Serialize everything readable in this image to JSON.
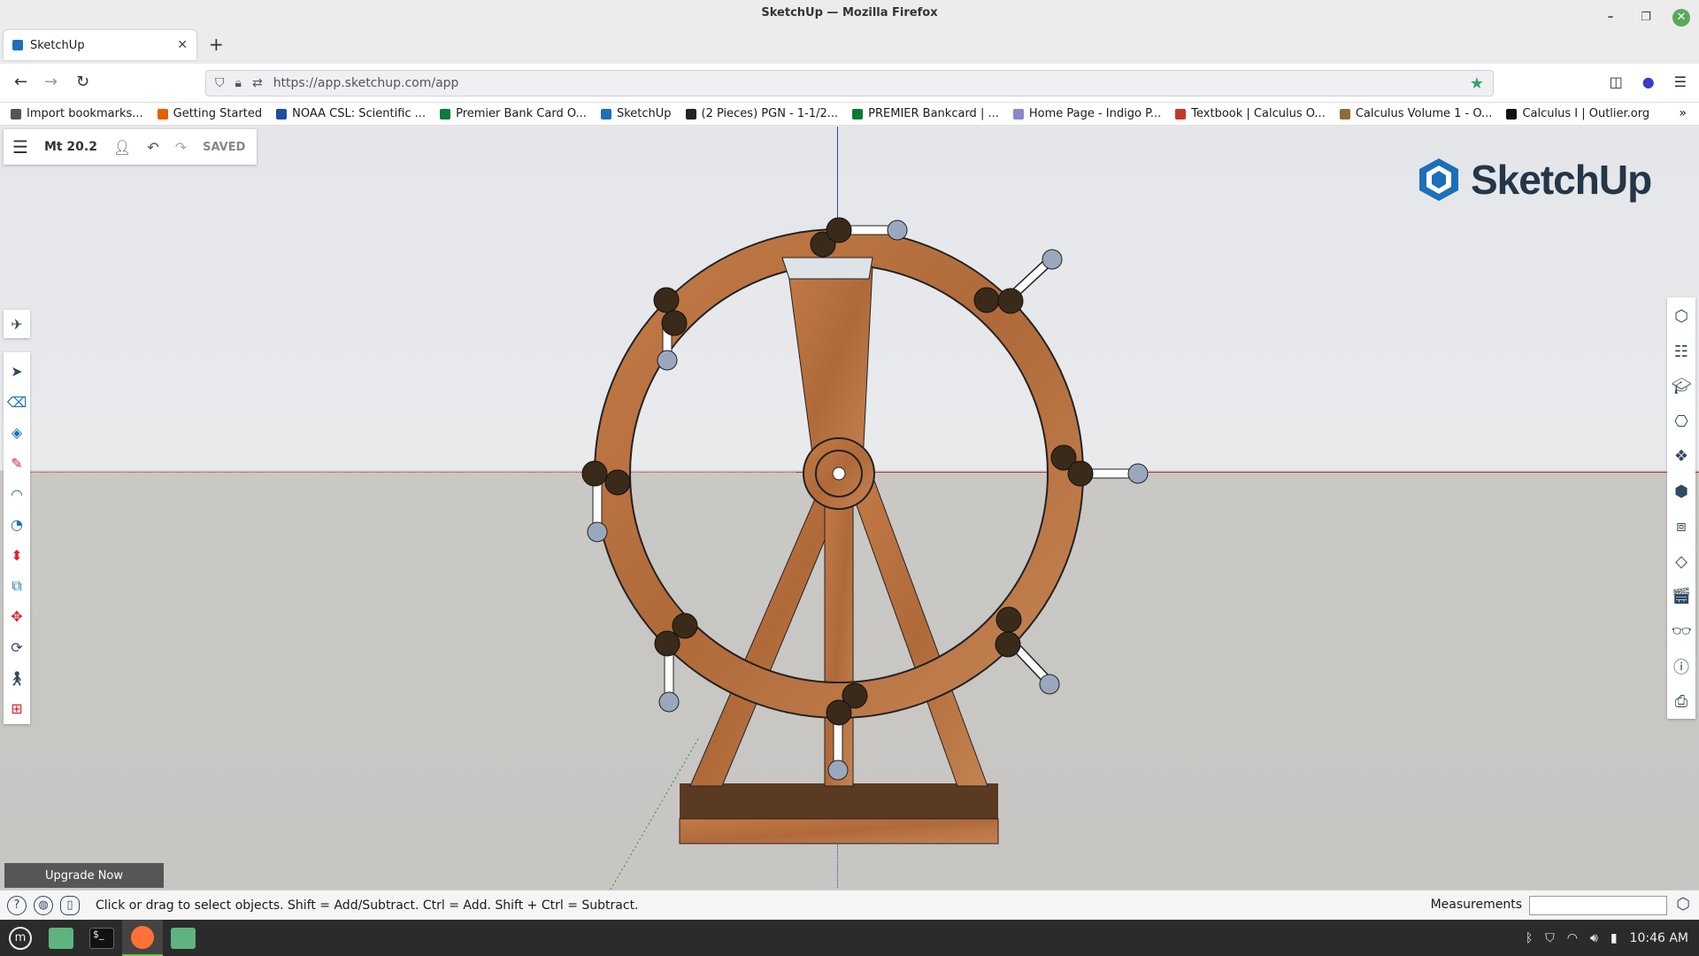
{
  "window": {
    "title": "SketchUp — Mozilla Firefox",
    "controls": {
      "minimize": "–",
      "maximize": "❐",
      "close": "✕"
    }
  },
  "browser": {
    "tab_title": "SketchUp",
    "tab_close": "✕",
    "new_tab": "+",
    "url": "https://app.sketchup.com/app",
    "bookmarks": [
      {
        "label": "Import bookmarks...",
        "color": "#555555"
      },
      {
        "label": "Getting Started",
        "color": "#e66000"
      },
      {
        "label": "NOAA CSL: Scientific ...",
        "color": "#1f4e9c"
      },
      {
        "label": "Premier Bank Card O...",
        "color": "#0a7a3a"
      },
      {
        "label": "SketchUp",
        "color": "#1d6fb8"
      },
      {
        "label": "(2 Pieces) PGN - 1-1/2...",
        "color": "#222222"
      },
      {
        "label": "PREMIER Bankcard | ...",
        "color": "#0a7a3a"
      },
      {
        "label": "Home Page - Indigo P...",
        "color": "#8888cc"
      },
      {
        "label": "Textbook | Calculus O...",
        "color": "#c0392b"
      },
      {
        "label": "Calculus Volume 1 - O...",
        "color": "#8a6d3b"
      },
      {
        "label": "Calculus I | Outlier.org",
        "color": "#111111"
      }
    ]
  },
  "sketchup": {
    "model_name": "Mt 20.2",
    "save_status": "SAVED",
    "logo_text": "SketchUp",
    "upgrade_label": "Upgrade Now",
    "status_text": "Click or drag to select objects. Shift = Add/Subtract. Ctrl = Add. Shift + Ctrl = Subtract.",
    "measurements_label": "Measurements",
    "left_tools": [
      "select-icon",
      "eraser-icon",
      "paint-bucket-icon",
      "pencil-icon",
      "arc-icon",
      "tape-measure-icon",
      "push-pull-icon",
      "offset-icon",
      "move-icon",
      "rotate-icon",
      "walk-icon",
      "section-icon"
    ],
    "right_tools": [
      "entity-info-icon",
      "outliner-icon",
      "instructor-icon",
      "components-icon",
      "materials-icon",
      "styles-icon",
      "scenes-icon",
      "tags-icon",
      "animation-icon",
      "display-icon",
      "info-icon",
      "export-icon"
    ]
  },
  "taskbar": {
    "clock": "10:46 AM"
  }
}
